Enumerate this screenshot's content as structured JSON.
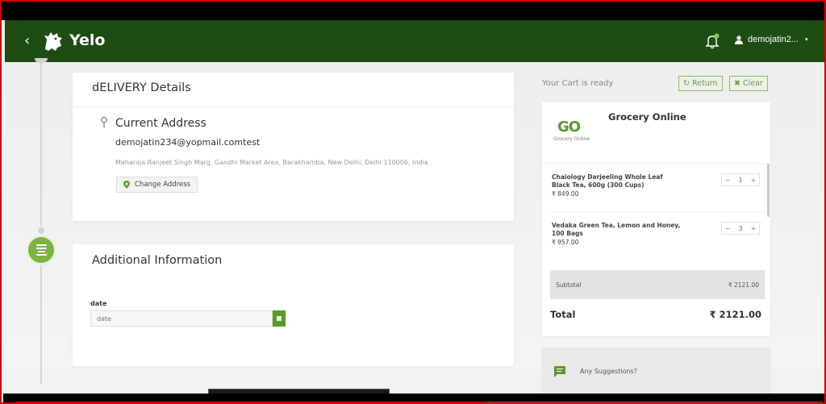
{
  "header": {
    "back_symbol": "‹",
    "app_name": "Yelo",
    "username": "demojatin2...",
    "caret": "▾",
    "brand_color": "#1e4d14",
    "notification_dot_color": "#8bc34a"
  },
  "delivery": {
    "title": "dELIVERY Details",
    "address_heading": "Current Address",
    "email": "demojatin234@yopmail.comtest",
    "address_line": "Maharaja Ranjeet Singh Marg, Gandhi Market Area, Barakhamba, New Delhi, Delhi 110006, India",
    "change_button": "Change Address"
  },
  "additional": {
    "title": "Additional Information",
    "date_label": "date",
    "date_placeholder": "date"
  },
  "cart": {
    "status": "Your Cart is ready",
    "return_icon": "↻",
    "return_label": "Return",
    "clear_icon": "✖",
    "clear_label": "Clear",
    "store_logo_text": "GO",
    "store_logo_caption": "Grocery Online",
    "store_name": "Grocery Online",
    "items": [
      {
        "name": "Chaiology Darjeeling Whole Leaf Black Tea, 600g (300 Cups)",
        "price": "₹ 849.00",
        "qty": "1"
      },
      {
        "name": "Vedaka Green Tea, Lemon and Honey, 100 Bags",
        "price": "₹ 957.00",
        "qty": "3"
      }
    ],
    "minus_symbol": "−",
    "plus_symbol": "+",
    "subtotal_label": "Subtotal",
    "subtotal_value": "₹ 2121.00",
    "total_label": "Total",
    "total_value": "₹ 2121.00",
    "accent_color": "#8bc34a"
  },
  "suggestions": {
    "label": "Any Suggestions?"
  },
  "video": {
    "progress_fraction": 0.58
  }
}
